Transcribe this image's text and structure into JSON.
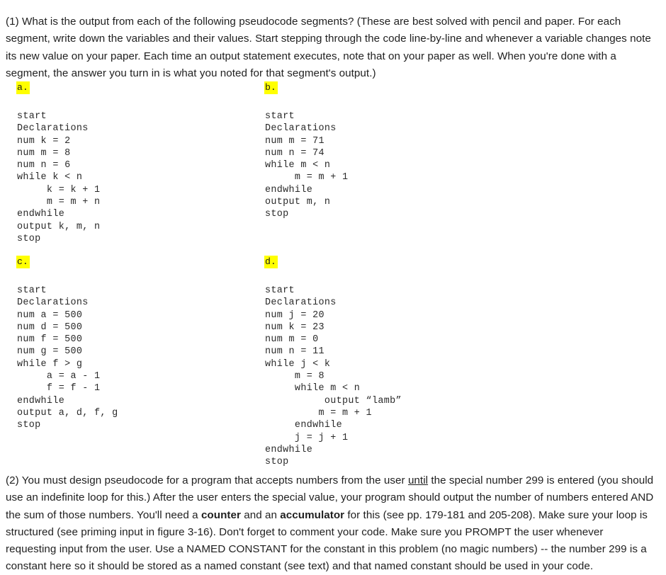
{
  "document": {
    "background_color": "#ffffff",
    "text_color": "#1f1f1f",
    "highlight_color": "#ffff00"
  },
  "questions": {
    "q1": {
      "number": "(1)",
      "text_parts": {
        "full": "(1) What is the output from each of the following pseudocode segments? (These are best solved with pencil and paper. For each segment, write down the variables and their values. Start stepping through the code line-by-line and whenever a variable changes note its new value on your paper. Each time an output statement executes, note that on your paper as well. When you're done with a segment, the answer you turn in is what you noted for that segment's output.)"
      }
    },
    "q2": {
      "number": "(2)",
      "lead": "(2) You must design pseudocode for a program that accepts numbers from the user ",
      "underlined_word": "until",
      "after_until": " the special number 299 is entered (you should use an indefinite loop for this.) After the user enters the special value, your program should output the number of numbers entered AND the sum of those numbers. You'll need a ",
      "bold_word_1": "counter",
      "between_bold": " and an ",
      "bold_word_2": "accumulator",
      "tail": " for this (see pp. 179-181 and 205-208). Make sure your loop is structured (see priming input in figure 3-16). Don't forget to comment your code. Make sure you PROMPT the user whenever requesting input from the user. Use a NAMED CONSTANT for the constant in this problem (no magic numbers) -- the number 299 is a constant here so it should be stored as a named constant (see text) and that named constant should be used in your code."
    }
  },
  "segments": {
    "a": {
      "label": "a.",
      "code": "start\nDeclarations\nnum k = 2\nnum m = 8\nnum n = 6\nwhile k < n\n     k = k + 1\n     m = m + n\nendwhile\noutput k, m, n\nstop"
    },
    "b": {
      "label": "b.",
      "code": "start\nDeclarations\nnum m = 71\nnum n = 74\nwhile m < n\n     m = m + 1\nendwhile\noutput m, n\nstop"
    },
    "c": {
      "label": "c.",
      "code": "start\nDeclarations\nnum a = 500\nnum d = 500\nnum f = 500\nnum g = 500\nwhile f > g\n     a = a - 1\n     f = f - 1\nendwhile\noutput a, d, f, g\nstop"
    },
    "d": {
      "label": "d.",
      "code": "start\nDeclarations\nnum j = 20\nnum k = 23\nnum m = 0\nnum n = 11\nwhile j < k\n     m = 8\n     while m < n\n          output “lamb”\n         m = m + 1\n     endwhile\n     j = j + 1\nendwhile\nstop"
    }
  }
}
